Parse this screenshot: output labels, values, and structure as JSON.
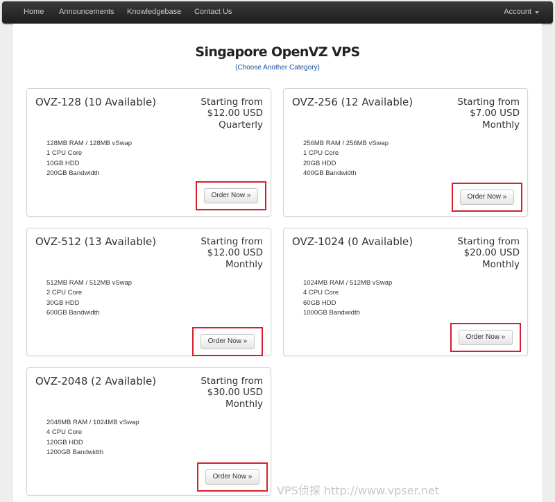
{
  "nav": {
    "items": [
      "Home",
      "Announcements",
      "Knowledgebase",
      "Contact Us"
    ],
    "account_label": "Account"
  },
  "page": {
    "title": "Singapore OpenVZ VPS",
    "category_link": "(Choose Another Category)"
  },
  "products": [
    {
      "title": "OVZ-128 (10 Available)",
      "price_prefix": "Starting from",
      "price": "$12.00 USD",
      "cycle": "Quarterly",
      "features": [
        "128MB RAM / 128MB vSwap",
        "1 CPU Core",
        "10GB HDD",
        "200GB Bandwidth"
      ],
      "button_label": "Order Now »"
    },
    {
      "title": "OVZ-256 (12 Available)",
      "price_prefix": "Starting from",
      "price": "$7.00 USD",
      "cycle": "Monthly",
      "features": [
        "256MB RAM / 256MB vSwap",
        "1 CPU Core",
        "20GB HDD",
        "400GB Bandwidth"
      ],
      "button_label": "Order Now »"
    },
    {
      "title": "OVZ-512 (13 Available)",
      "price_prefix": "Starting from",
      "price": "$12.00 USD",
      "cycle": "Monthly",
      "features": [
        "512MB RAM / 512MB vSwap",
        "2 CPU Core",
        "30GB HDD",
        "600GB Bandwidth"
      ],
      "button_label": "Order Now »"
    },
    {
      "title": "OVZ-1024 (0 Available)",
      "price_prefix": "Starting from",
      "price": "$20.00 USD",
      "cycle": "Monthly",
      "features": [
        "1024MB RAM / 512MB vSwap",
        "4 CPU Core",
        "60GB HDD",
        "1000GB Bandwidth"
      ],
      "button_label": "Order Now »"
    },
    {
      "title": "OVZ-2048 (2 Available)",
      "price_prefix": "Starting from",
      "price": "$30.00 USD",
      "cycle": "Monthly",
      "features": [
        "2048MB RAM / 1024MB vSwap",
        "4 CPU Core",
        "120GB HDD",
        "1200GB Bandwidth"
      ],
      "button_label": "Order Now »"
    }
  ],
  "watermark": "VPS侦探 http://www.vpser.net",
  "colors": {
    "navbar": "#1d1d1d",
    "link": "#1a4fa0",
    "highlight_box": "#d4202c"
  }
}
